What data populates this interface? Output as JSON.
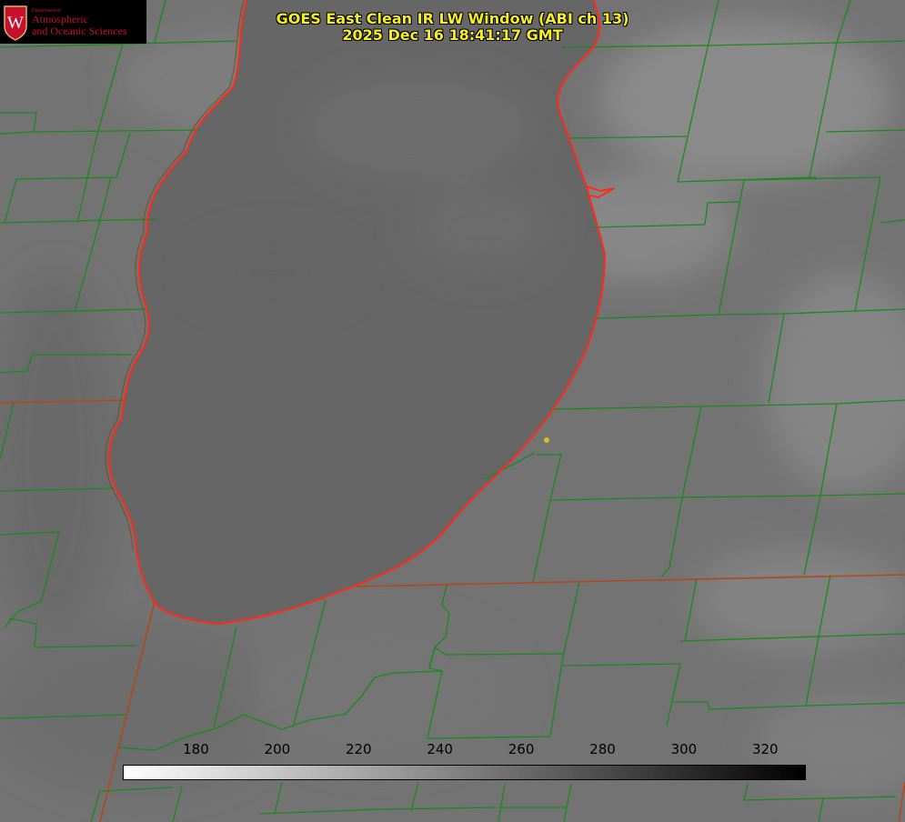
{
  "title": {
    "line1": "GOES East Clean IR LW Window (ABI ch 13)",
    "line2": "2025 Dec 16 18:41:17 GMT"
  },
  "logo": {
    "crest_letter": "W",
    "dept": "Department of",
    "line1": "Atmospheric",
    "line2": "and Oceanic Sciences"
  },
  "colorbar": {
    "min": 162,
    "max": 330,
    "ticks": [
      "180",
      "200",
      "220",
      "240",
      "260",
      "280",
      "300",
      "320"
    ],
    "gradient_from": "#ffffff",
    "gradient_to": "#000000"
  },
  "colors": {
    "county_lines": "#1a8a1a",
    "state_lines": "#b2481e",
    "shoreline": "#ff2a1a",
    "title_text": "#f4ee22",
    "marker": "#d6c21c",
    "land_cloud": "#777777",
    "lake": "#666666"
  },
  "marker": {
    "icon": "location-dot-icon"
  }
}
